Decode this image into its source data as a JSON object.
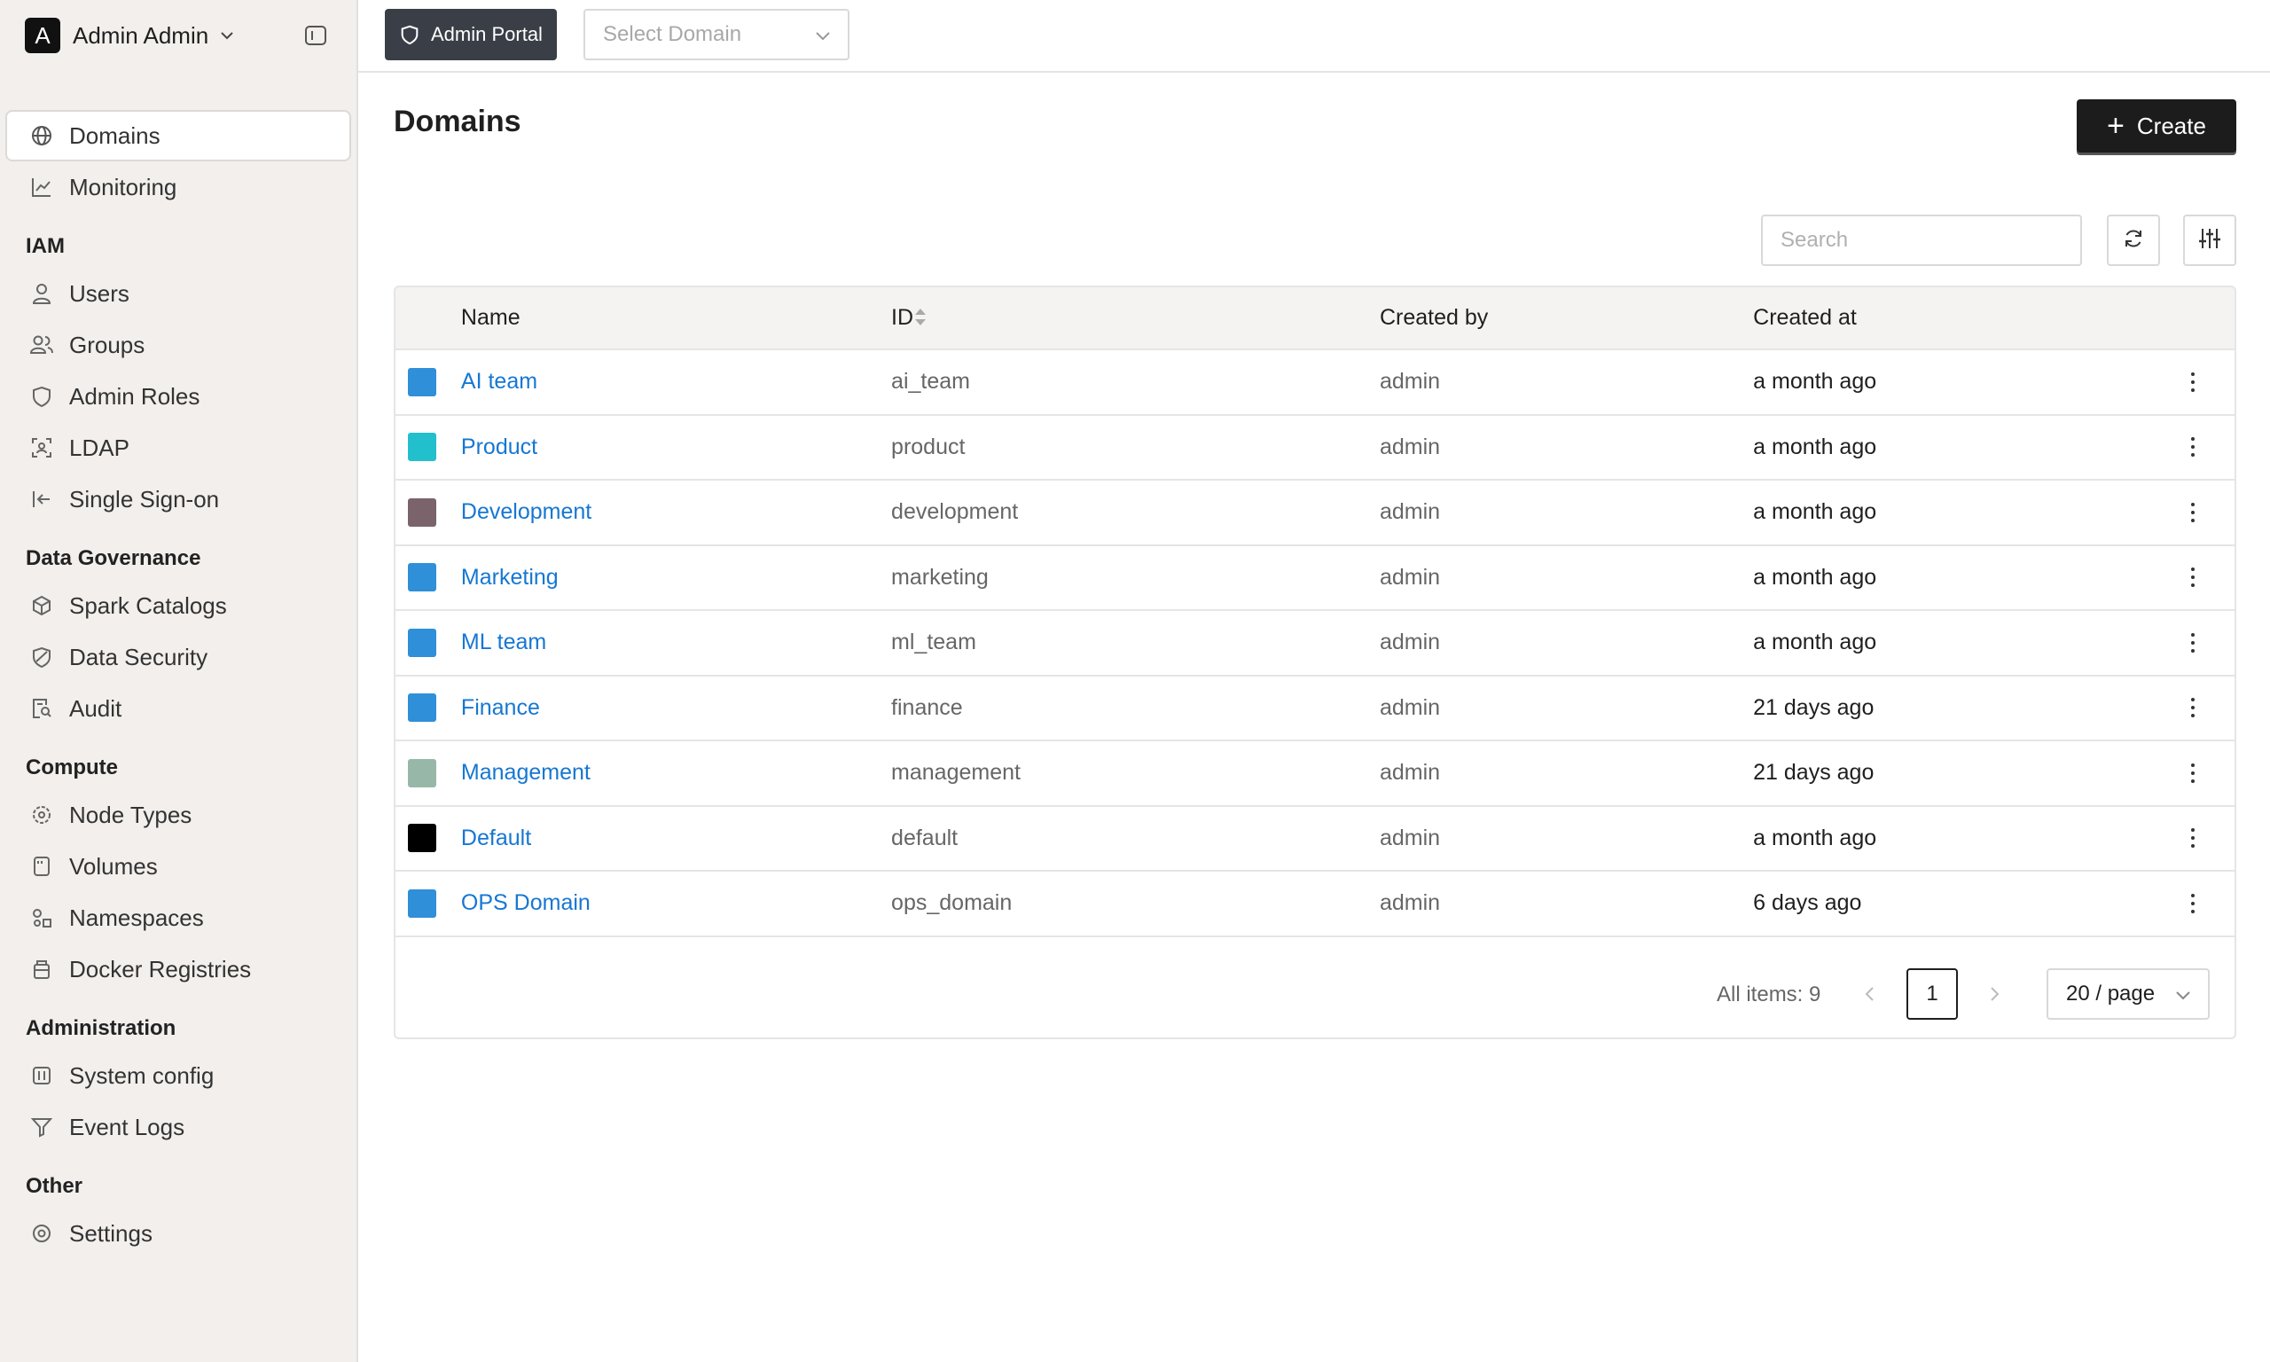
{
  "sidebar": {
    "avatar_letter": "A",
    "user_name": "Admin Admin",
    "items": {
      "domains": "Domains",
      "monitoring": "Monitoring",
      "users": "Users",
      "groups": "Groups",
      "admin_roles": "Admin Roles",
      "ldap": "LDAP",
      "sso": "Single Sign-on",
      "spark_catalogs": "Spark Catalogs",
      "data_security": "Data Security",
      "audit": "Audit",
      "node_types": "Node Types",
      "volumes": "Volumes",
      "namespaces": "Namespaces",
      "docker_registries": "Docker Registries",
      "system_config": "System config",
      "event_logs": "Event Logs",
      "settings": "Settings"
    },
    "sections": {
      "iam": "IAM",
      "data_governance": "Data Governance",
      "compute": "Compute",
      "administration": "Administration",
      "other": "Other"
    },
    "active_item": "Domains"
  },
  "topbar": {
    "portal_label": "Admin Portal",
    "domain_placeholder": "Select Domain"
  },
  "main": {
    "title": "Domains",
    "create_label": "Create",
    "search_placeholder": "Search"
  },
  "table": {
    "columns": {
      "name": "Name",
      "id": "ID",
      "created_by": "Created by",
      "created_at": "Created at"
    },
    "rows": [
      {
        "color": "#2f8fd8",
        "name": "AI team",
        "id": "ai_team",
        "created_by": "admin",
        "created_at": "a month ago"
      },
      {
        "color": "#22bfcc",
        "name": "Product",
        "id": "product",
        "created_by": "admin",
        "created_at": "a month ago"
      },
      {
        "color": "#7a636a",
        "name": "Development",
        "id": "development",
        "created_by": "admin",
        "created_at": "a month ago"
      },
      {
        "color": "#2f8fd8",
        "name": "Marketing",
        "id": "marketing",
        "created_by": "admin",
        "created_at": "a month ago"
      },
      {
        "color": "#2f8fd8",
        "name": "ML team",
        "id": "ml_team",
        "created_by": "admin",
        "created_at": "a month ago"
      },
      {
        "color": "#2f8fd8",
        "name": "Finance",
        "id": "finance",
        "created_by": "admin",
        "created_at": "21 days ago"
      },
      {
        "color": "#97b8a8",
        "name": "Management",
        "id": "management",
        "created_by": "admin",
        "created_at": "21 days ago"
      },
      {
        "color": "#000000",
        "name": "Default",
        "id": "default",
        "created_by": "admin",
        "created_at": "a month ago"
      },
      {
        "color": "#2f8fd8",
        "name": "OPS Domain",
        "id": "ops_domain",
        "created_by": "admin",
        "created_at": "6 days ago"
      }
    ]
  },
  "pagination": {
    "all_items": "All items: 9",
    "current_page": "1",
    "page_size": "20 / page"
  },
  "colors": {
    "link": "#1677d2",
    "primary_button": "#1c1c1c",
    "sidebar_bg": "#f2efec"
  }
}
